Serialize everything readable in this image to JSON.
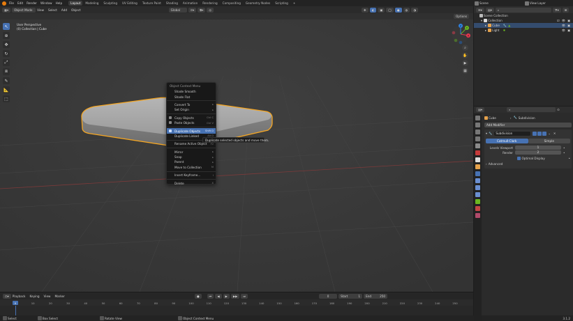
{
  "menubar": {
    "menus": [
      "File",
      "Edit",
      "Render",
      "Window",
      "Help"
    ],
    "workspaces": [
      "Layout",
      "Modeling",
      "Sculpting",
      "UV Editing",
      "Texture Paint",
      "Shading",
      "Animation",
      "Rendering",
      "Compositing",
      "Geometry Nodes",
      "Scripting"
    ],
    "add_tab": "+",
    "scene": "Scene",
    "view_layer": "View Layer"
  },
  "viewport": {
    "mode": "Object Mode",
    "menus": [
      "View",
      "Select",
      "Add",
      "Object"
    ],
    "orientation": "Global",
    "options": "Options",
    "overlay_line1": "User Perspective",
    "overlay_line2": "(0) Collection | Cube",
    "gizmo": {
      "x": "X",
      "y": "Y",
      "z": "Z"
    }
  },
  "context_menu": {
    "title": "Object Context Menu",
    "items": [
      {
        "label": "Shade Smooth",
        "shortcut": ""
      },
      {
        "label": "Shade Flat",
        "shortcut": ""
      },
      {
        "label": "Convert To",
        "shortcut": "▸"
      },
      {
        "label": "Set Origin",
        "shortcut": "▸"
      },
      {
        "label": "Copy Objects",
        "shortcut": "Ctrl C"
      },
      {
        "label": "Paste Objects",
        "shortcut": "Ctrl V"
      },
      {
        "label": "Duplicate Objects",
        "shortcut": "Shift D"
      },
      {
        "label": "Duplicate Linked",
        "shortcut": "Alt D"
      },
      {
        "label": "Rename Active Object",
        "shortcut": "F2"
      },
      {
        "label": "Mirror",
        "shortcut": "▸"
      },
      {
        "label": "Snap",
        "shortcut": "▸"
      },
      {
        "label": "Parent",
        "shortcut": "▸"
      },
      {
        "label": "Move to Collection",
        "shortcut": "M"
      },
      {
        "label": "Insert Keyframe...",
        "shortcut": "I"
      },
      {
        "label": "Delete",
        "shortcut": "X"
      }
    ],
    "tooltip": "Duplicate selected objects and move them."
  },
  "timeline": {
    "menus": [
      "Playback",
      "Keying",
      "View",
      "Marker"
    ],
    "current_frame": "0",
    "start_label": "Start",
    "start": "1",
    "end_label": "End",
    "end": "250",
    "ticks": [
      "0",
      "10",
      "20",
      "30",
      "40",
      "50",
      "60",
      "70",
      "80",
      "90",
      "100",
      "110",
      "120",
      "130",
      "140",
      "150",
      "160",
      "170",
      "180",
      "190",
      "200",
      "210",
      "220",
      "230",
      "240",
      "250"
    ]
  },
  "statusbar": {
    "select": "Select",
    "box_select": "Box Select",
    "rotate_view": "Rotate View",
    "object_context_menu": "Object Context Menu",
    "version": "3.1.2"
  },
  "outliner": {
    "root": "Scene Collection",
    "collection": "Collection",
    "items": [
      {
        "name": "Cube",
        "selected": true
      },
      {
        "name": "Light",
        "selected": false
      }
    ]
  },
  "properties": {
    "object_name": "Cube",
    "modifier_name": "Subdivision",
    "add_modifier": "Add Modifier",
    "type_catmull": "Catmull-Clark",
    "type_simple": "Simple",
    "levels_viewport_label": "Levels Viewport",
    "levels_viewport_value": "1",
    "render_label": "Render",
    "render_value": "2",
    "optimal_display": "Optimal Display",
    "advanced": "Advanced"
  },
  "colors": {
    "accent": "#4772b3",
    "selection_outline": "#f5a623",
    "x_axis": "#e8384f",
    "y_axis": "#6bb620",
    "z_axis": "#2f83e3"
  }
}
